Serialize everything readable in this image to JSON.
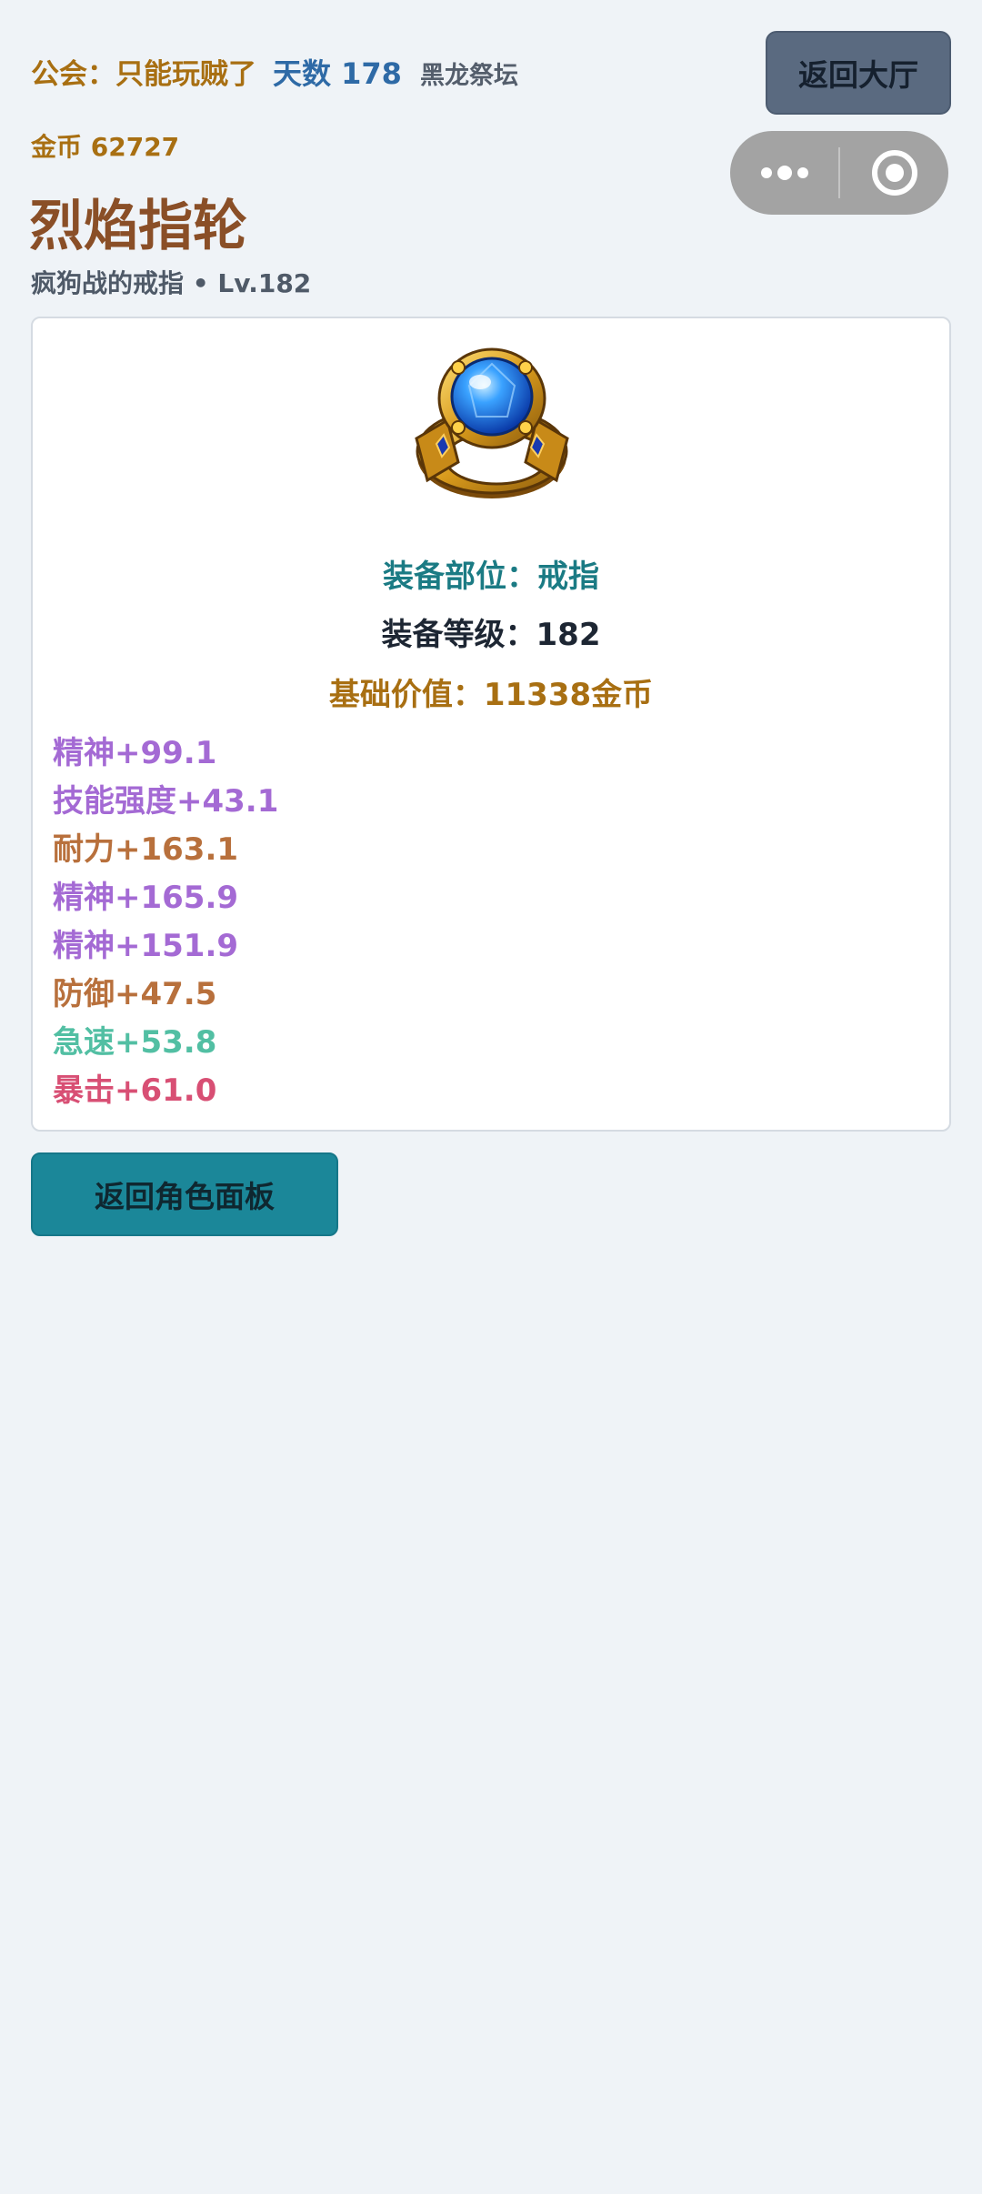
{
  "header": {
    "guild": "公会：只能玩贼了",
    "day": "天数 178",
    "map": "黑龙祭坛",
    "gold": "金币 62727",
    "lobby_button": "返回大厅"
  },
  "capsule": {
    "more_icon": "more-dots-icon",
    "close_icon": "target-circle-icon"
  },
  "item": {
    "name": "烈焰指轮",
    "subtitle": "疯狗战的戒指 • Lv.182",
    "image_icon": "sapphire-ring-icon",
    "slot": "装备部位：戒指",
    "level": "装备等级：182",
    "value": "基础价值：11338金币"
  },
  "stats": [
    {
      "text": "精神+99.1",
      "color": "#a46ad4"
    },
    {
      "text": "技能强度+43.1",
      "color": "#a46ad4"
    },
    {
      "text": "耐力+163.1",
      "color": "#b8703c"
    },
    {
      "text": "精神+165.9",
      "color": "#a46ad4"
    },
    {
      "text": "精神+151.9",
      "color": "#a46ad4"
    },
    {
      "text": "防御+47.5",
      "color": "#b8703c"
    },
    {
      "text": "急速+53.8",
      "color": "#52bfa3"
    },
    {
      "text": "暴击+61.0",
      "color": "#d84f74"
    }
  ],
  "footer": {
    "back_button": "返回角色面板"
  },
  "colors": {
    "background": "#eff3f7",
    "guild_gold": "#a86f12",
    "day_blue": "#2e6aa6",
    "title_brown": "#8a4f27",
    "slot_teal": "#1b7b84",
    "back_button": "#1b8799",
    "lobby_button": "#5a6a80"
  }
}
